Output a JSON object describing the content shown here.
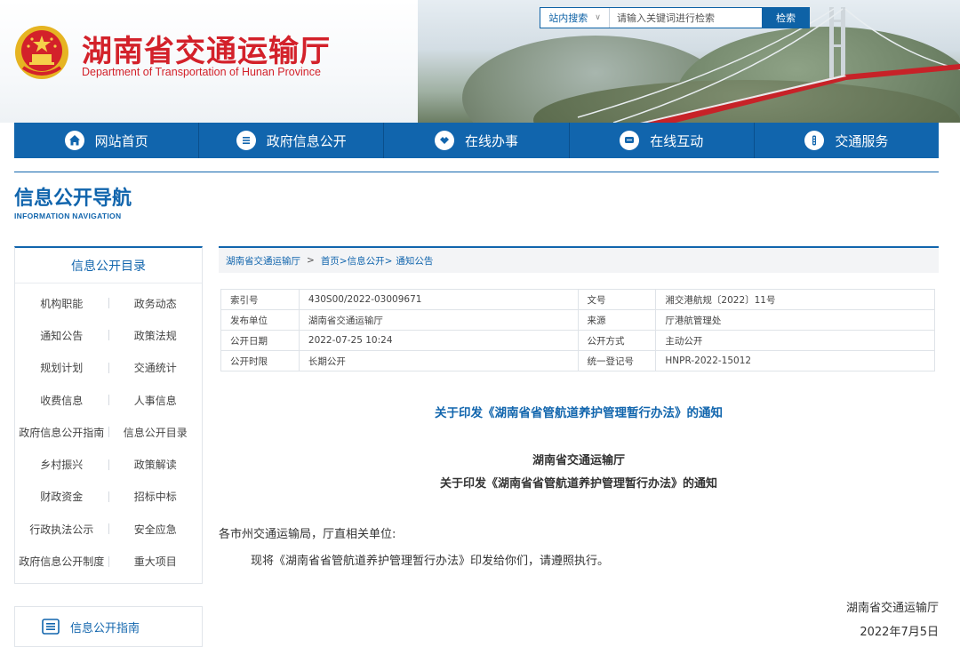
{
  "header": {
    "title": "湖南省交通运输厅",
    "subtitle": "Department of Transportation of Hunan Province",
    "emblem_icon": "national-emblem-icon",
    "brand_color": "#d3212a"
  },
  "search": {
    "scope_label": "站内搜索",
    "placeholder": "请输入关键词进行检索",
    "button_label": "检索"
  },
  "nav": {
    "color": "#1165ad",
    "items": [
      {
        "label": "网站首页",
        "icon": "home-icon"
      },
      {
        "label": "政府信息公开",
        "icon": "document-list-icon"
      },
      {
        "label": "在线办事",
        "icon": "handshake-icon"
      },
      {
        "label": "在线互动",
        "icon": "chat-icon"
      },
      {
        "label": "交通服务",
        "icon": "traffic-light-icon"
      }
    ]
  },
  "section": {
    "title": "信息公开导航",
    "subtitle": "Information Navigation"
  },
  "sidebar": {
    "heading": "信息公开目录",
    "rows": [
      [
        "机构职能",
        "政务动态"
      ],
      [
        "通知公告",
        "政策法规"
      ],
      [
        "规划计划",
        "交通统计"
      ],
      [
        "收费信息",
        "人事信息"
      ],
      [
        "政府信息公开指南",
        "信息公开目录"
      ],
      [
        "乡村振兴",
        "政策解读"
      ],
      [
        "财政资金",
        "招标中标"
      ],
      [
        "行政执法公示",
        "安全应急"
      ],
      [
        "政府信息公开制度",
        "重大项目"
      ]
    ],
    "guide_label": "信息公开指南"
  },
  "breadcrumb": {
    "items": [
      "湖南省交通运输厅",
      "首页>信息公开>",
      "通知公告"
    ]
  },
  "meta": {
    "rows": [
      [
        "索引号",
        "430S00/2022-03009671",
        "文号",
        "湘交港航规〔2022〕11号"
      ],
      [
        "发布单位",
        "湖南省交通运输厅",
        "来源",
        "厅港航管理处"
      ],
      [
        "公开日期",
        "2022-07-25 10:24",
        "公开方式",
        "主动公开"
      ],
      [
        "公开时限",
        "长期公开",
        "统一登记号",
        "HNPR-2022-15012"
      ]
    ]
  },
  "document": {
    "title": "关于印发《湖南省省管航道养护管理暂行办法》的通知",
    "issuer": "湖南省交通运输厅",
    "heading": "关于印发《湖南省省管航道养护管理暂行办法》的通知",
    "salutation": "各市州交通运输局，厅直相关单位:",
    "body": "现将《湖南省省管航道养护管理暂行办法》印发给你们，请遵照执行。",
    "sign_org": "湖南省交通运输厅",
    "sign_date": "2022年7月5日"
  }
}
